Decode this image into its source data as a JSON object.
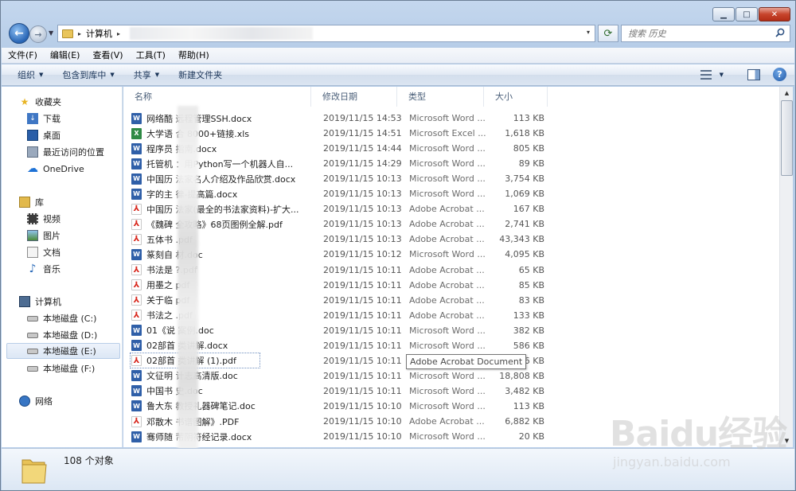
{
  "address": {
    "segment": "计算机",
    "separator": "▸",
    "dropdown": "▾"
  },
  "search": {
    "placeholder": "搜索 历史"
  },
  "menu": [
    "文件(F)",
    "编辑(E)",
    "查看(V)",
    "工具(T)",
    "帮助(H)"
  ],
  "toolbar": {
    "organize": "组织",
    "include_library": "包含到库中",
    "share": "共享",
    "new_folder": "新建文件夹",
    "help": "?"
  },
  "navpane": {
    "favorites": "收藏夹",
    "downloads": "下载",
    "desktop": "桌面",
    "recent": "最近访问的位置",
    "onedrive": "OneDrive",
    "libraries": "库",
    "videos": "视频",
    "pictures": "图片",
    "documents": "文档",
    "music": "音乐",
    "computer": "计算机",
    "drive_c": "本地磁盘 (C:)",
    "drive_d": "本地磁盘 (D:)",
    "drive_e": "本地磁盘 (E:)",
    "drive_f": "本地磁盘 (F:)",
    "network": "网络"
  },
  "columns": {
    "name": "名称",
    "date": "修改日期",
    "type": "类型",
    "size": "大小"
  },
  "files": [
    {
      "name": "网络酷    远程管理SSH.docx",
      "date": "2019/11/15 14:53",
      "type": "Microsoft Word ...",
      "size": "113 KB",
      "kind": "word"
    },
    {
      "name": "大学语      合 8000+链接.xls",
      "date": "2019/11/15 14:51",
      "type": "Microsoft Excel ...",
      "size": "1,618 KB",
      "kind": "excel"
    },
    {
      "name": "程序员      指南.docx",
      "date": "2019/11/15 14:44",
      "type": "Microsoft Word ...",
      "size": "805 KB",
      "kind": "word"
    },
    {
      "name": "托管机     ：用Python写一个机器人自...",
      "date": "2019/11/15 14:29",
      "type": "Microsoft Word ...",
      "size": "89 KB",
      "kind": "word"
    },
    {
      "name": "中国历     法家名人介绍及作品欣赏.docx",
      "date": "2019/11/15 10:13",
      "type": "Microsoft Word ...",
      "size": "3,754 KB",
      "kind": "word"
    },
    {
      "name": "字的主      律-提高篇.docx",
      "date": "2019/11/15 10:13",
      "type": "Microsoft Word ...",
      "size": "1,069 KB",
      "kind": "word"
    },
    {
      "name": "中国历     法家(最全的书法家资料)-扩大...",
      "date": "2019/11/15 10:13",
      "type": "Adobe Acrobat ...",
      "size": "167 KB",
      "kind": "pdf"
    },
    {
      "name": "《魏碑      全攻略》68页图例全解.pdf",
      "date": "2019/11/15 10:13",
      "type": "Adobe Acrobat ...",
      "size": "2,741 KB",
      "kind": "pdf"
    },
    {
      "name": "五体书      .pdf",
      "date": "2019/11/15 10:13",
      "type": "Adobe Acrobat ...",
      "size": "43,343 KB",
      "kind": "pdf"
    },
    {
      "name": "篆刻自      材.doc",
      "date": "2019/11/15 10:12",
      "type": "Microsoft Word ...",
      "size": "4,095 KB",
      "kind": "word"
    },
    {
      "name": "书法是      ?.pdf",
      "date": "2019/11/15 10:11",
      "type": "Adobe Acrobat ...",
      "size": "65 KB",
      "kind": "pdf"
    },
    {
      "name": "用墨之      pdf",
      "date": "2019/11/15 10:11",
      "type": "Adobe Acrobat ...",
      "size": "85 KB",
      "kind": "pdf"
    },
    {
      "name": "关于临      pdf",
      "date": "2019/11/15 10:11",
      "type": "Adobe Acrobat ...",
      "size": "83 KB",
      "kind": "pdf"
    },
    {
      "name": "书法之      .pdf",
      "date": "2019/11/15 10:11",
      "type": "Adobe Acrobat ...",
      "size": "133 KB",
      "kind": "pdf"
    },
    {
      "name": "01《说      案例.doc",
      "date": "2019/11/15 10:11",
      "type": "Microsoft Word ...",
      "size": "382 KB",
      "kind": "word"
    },
    {
      "name": "02部首      类讲解.docx",
      "date": "2019/11/15 10:11",
      "type": "Microsoft Word ...",
      "size": "586 KB",
      "kind": "word"
    },
    {
      "name": "02部首      类讲解 (1).pdf",
      "date": "2019/11/15 10:11",
      "type": "Adobe Acrobat ...",
      "size": "6 KB",
      "kind": "pdf"
    },
    {
      "name": "文征明      计志高清版.doc",
      "date": "2019/11/15 10:11",
      "type": "Microsoft Word ...",
      "size": "18,808 KB",
      "kind": "word"
    },
    {
      "name": "中国书      史.doc",
      "date": "2019/11/15 10:11",
      "type": "Microsoft Word ...",
      "size": "3,482 KB",
      "kind": "word"
    },
    {
      "name": "鲁大东      教授礼器碑笔记.doc",
      "date": "2019/11/15 10:10",
      "type": "Microsoft Word ...",
      "size": "113 KB",
      "kind": "word"
    },
    {
      "name": "邓散木      书谱图解》.PDF",
      "date": "2019/11/15 10:10",
      "type": "Adobe Acrobat ...",
      "size": "6,882 KB",
      "kind": "pdf"
    },
    {
      "name": "骞师随      芾阴符经记录.docx",
      "date": "2019/11/15 10:10",
      "type": "Microsoft Word ...",
      "size": "20 KB",
      "kind": "word"
    }
  ],
  "tooltip": "Adobe Acrobat Document",
  "status": {
    "count": "108 个对象"
  },
  "watermark": {
    "main": "Baidu经验",
    "sub": "jingyan.baidu.com"
  },
  "colors": {
    "word": "#2f5fa8",
    "excel": "#2f8a45",
    "pdf": "#d8261b",
    "frame": "#b9cfea"
  }
}
